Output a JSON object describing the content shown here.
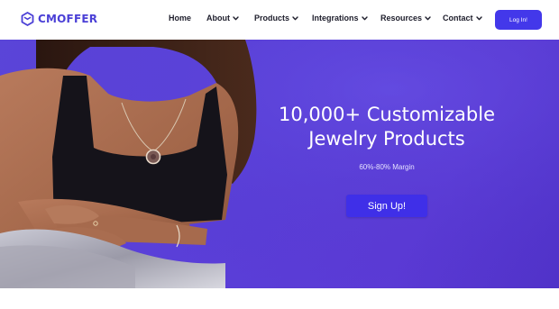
{
  "brand": {
    "name": "CMOFFER",
    "color": "#4a3fd6"
  },
  "nav": {
    "items": [
      {
        "label": "Home",
        "has_dropdown": false,
        "active": true
      },
      {
        "label": "About",
        "has_dropdown": true
      },
      {
        "label": "Products",
        "has_dropdown": true
      },
      {
        "label": "Integrations",
        "has_dropdown": true
      },
      {
        "label": "Resources",
        "has_dropdown": true
      },
      {
        "label": "Contact",
        "has_dropdown": true
      }
    ],
    "login_label": "Log In!",
    "accent": "#4338ea"
  },
  "hero": {
    "title_line1": "10,000+ Customizable",
    "title_line2": "Jewelry Products",
    "subtitle": "60%-80% Margin",
    "cta_label": "Sign Up!",
    "background": "#5a3fd8"
  }
}
